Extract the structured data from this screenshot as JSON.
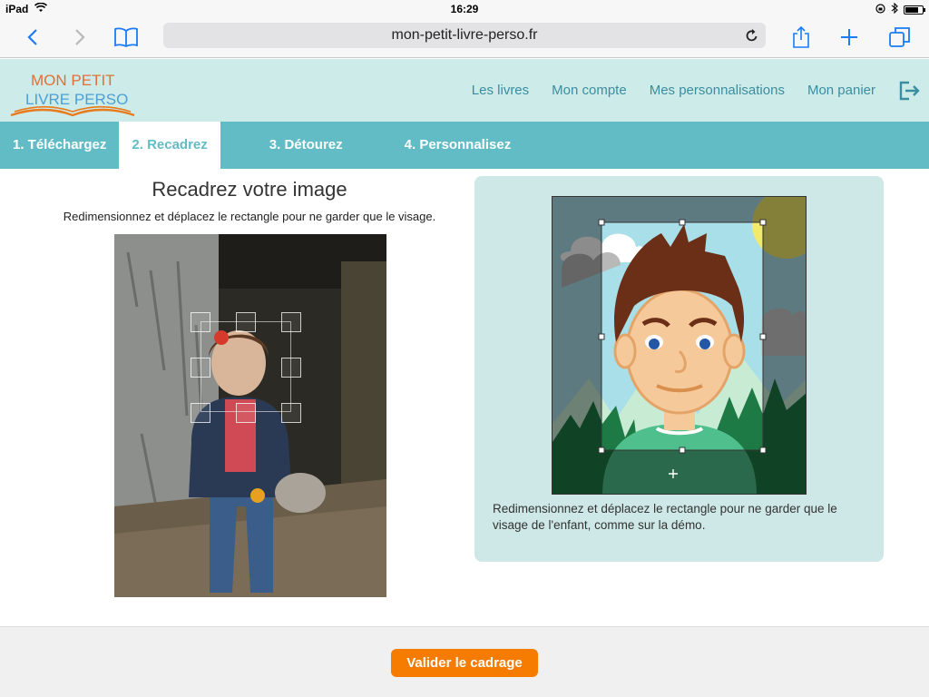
{
  "status_bar": {
    "device": "iPad",
    "time": "16:29"
  },
  "browser": {
    "url": "mon-petit-livre-perso.fr"
  },
  "site": {
    "logo_line1": "MON PETIT",
    "logo_line2": "LIVRE PERSO",
    "nav": [
      "Les livres",
      "Mon compte",
      "Mes personnalisations",
      "Mon panier"
    ]
  },
  "steps": [
    {
      "label": "1. Téléchargez",
      "active": false
    },
    {
      "label": "2. Recadrez",
      "active": true
    },
    {
      "label": "3. Détourez",
      "active": false
    },
    {
      "label": "4. Personnalisez",
      "active": false
    }
  ],
  "main": {
    "title": "Recadrez votre image",
    "subtitle": "Redimensionnez et déplacez le rectangle pour ne garder que le visage."
  },
  "demo": {
    "caption": "Redimensionnez et déplacez le rectangle pour ne garder que le visage de l'enfant, comme sur la démo."
  },
  "footer": {
    "validate_label": "Valider le cadrage"
  },
  "colors": {
    "header_bg": "#cdebe8",
    "steps_bg": "#62bcc6",
    "link": "#3a8ea0",
    "cta": "#f57c00"
  }
}
